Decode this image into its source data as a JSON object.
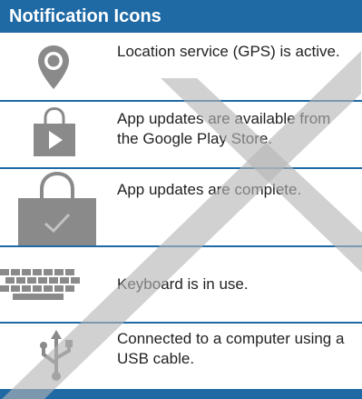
{
  "colors": {
    "header_bg": "#1f6aa5",
    "divider": "#1f6aa5",
    "icon_gray": "#8a8a8a",
    "watermark_gray": "#b5b5b5"
  },
  "header": {
    "title": "Notification Icons"
  },
  "rows": [
    {
      "icon": "location-pin-icon",
      "text": "Location service (GPS) is active."
    },
    {
      "icon": "play-store-bag-icon",
      "text": "App updates are available from the Google Play Store."
    },
    {
      "icon": "play-store-check-icon",
      "text": "App updates are complete."
    },
    {
      "icon": "keyboard-icon",
      "text": "Keyboard is in use."
    },
    {
      "icon": "usb-icon",
      "text": "Connected to a computer using a USB cable."
    }
  ]
}
